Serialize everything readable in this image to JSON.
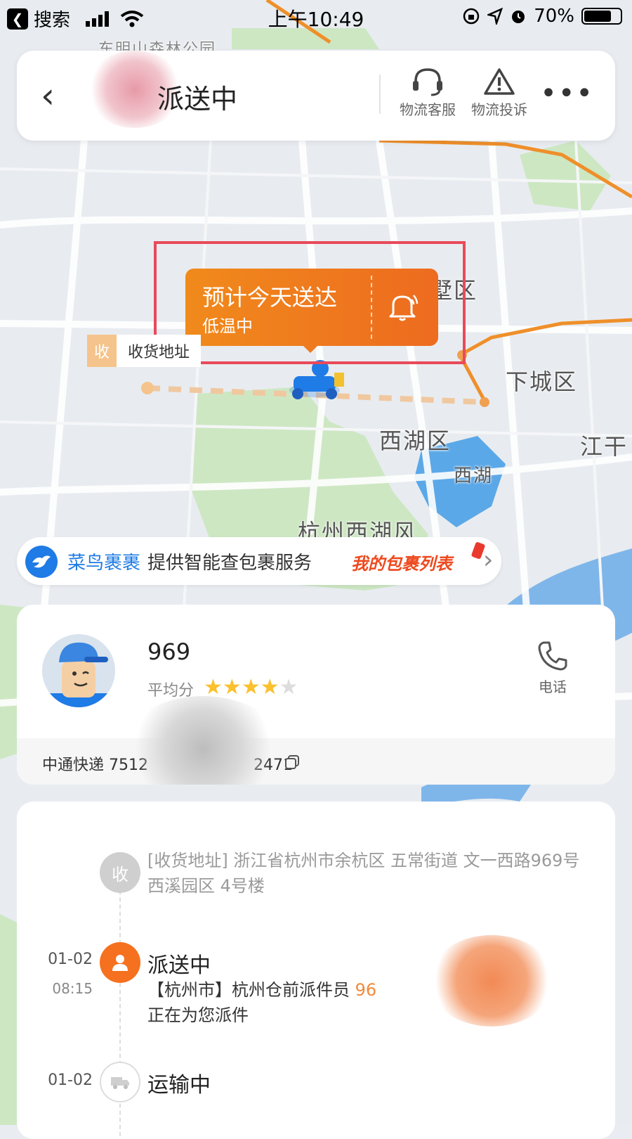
{
  "status_bar": {
    "back_app": "搜索",
    "time": "上午10:49",
    "battery": "70%"
  },
  "header": {
    "title": "派送中",
    "actions": [
      {
        "label": "物流客服",
        "icon": "headset-icon"
      },
      {
        "label": "物流投诉",
        "icon": "warning-icon"
      }
    ]
  },
  "map": {
    "labels": [
      "西湖区",
      "西湖",
      "下城区",
      "江干",
      "杭州西湖风",
      "墅区",
      "东明山森林公园"
    ],
    "eta": {
      "title": "预计今天送达",
      "subtitle": "低温中"
    },
    "receiver_tag": {
      "key": "收",
      "value": "收货地址"
    }
  },
  "promo": {
    "brand": "菜鸟裹裹",
    "text": "提供智能查包裹服务",
    "link": "我的包裹列表"
  },
  "courier": {
    "name": "969",
    "avg_label": "平均分",
    "rating": 4,
    "rating_max": 5,
    "phone_label": "电话",
    "tracking": "中通快递 7512",
    "tracking_tail": "2471"
  },
  "timeline": {
    "address": {
      "node": "收",
      "text": "[收货地址] 浙江省杭州市余杭区  五常街道   文一西路969号西溪园区 4号楼"
    },
    "events": [
      {
        "date": "01-02",
        "time": "08:15",
        "status": "派送中",
        "desc_prefix": "【杭州市】杭州仓前派件员 ",
        "desc_phone": "96",
        "desc_phone_tail": "205",
        "desc_suffix": "正在为您派件"
      },
      {
        "date": "01-02",
        "status": "运输中"
      }
    ]
  }
}
